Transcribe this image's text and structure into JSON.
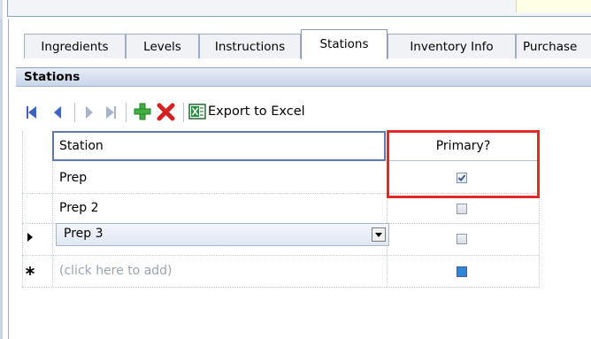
{
  "tabs": [
    {
      "label": "Ingredients",
      "active": false
    },
    {
      "label": "Levels",
      "active": false
    },
    {
      "label": "Instructions",
      "active": false
    },
    {
      "label": "Stations",
      "active": true
    },
    {
      "label": "Inventory Info",
      "active": false
    },
    {
      "label": "Purchase",
      "active": false
    }
  ],
  "section": {
    "title": "Stations"
  },
  "toolbar": {
    "export_label": "Export to Excel",
    "icons": [
      "first-record-icon",
      "previous-record-icon",
      "next-record-icon",
      "last-record-icon",
      "add-icon",
      "delete-icon",
      "excel-icon"
    ]
  },
  "grid": {
    "columns": {
      "station": "Station",
      "primary": "Primary?"
    },
    "rows": [
      {
        "station": "Prep",
        "primary": true
      },
      {
        "station": "Prep 2",
        "primary": false
      },
      {
        "station": "Prep 3",
        "primary": false
      }
    ],
    "new_row_placeholder": "(click here to add)"
  },
  "colors": {
    "highlight": "#e22a2a",
    "header_border": "#5f79b0",
    "add_icon": "#3fb040",
    "delete_icon": "#d42020"
  }
}
